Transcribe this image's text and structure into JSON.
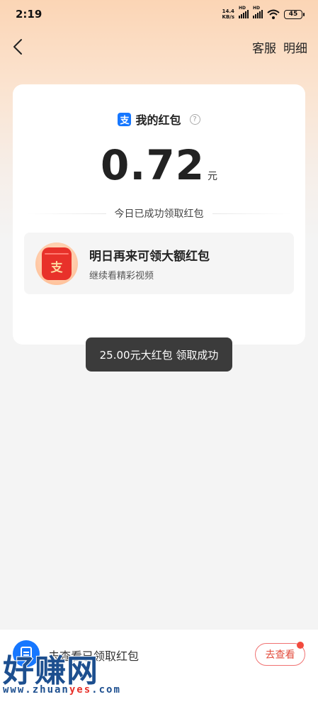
{
  "status_bar": {
    "time": "2:19",
    "net_speed_value": "14.4",
    "net_speed_unit": "KB/s",
    "hd_label": "HD",
    "battery": "45"
  },
  "header": {
    "service_label": "客服",
    "detail_label": "明细"
  },
  "card": {
    "logo_glyph": "支",
    "title": "我的红包",
    "help_glyph": "?",
    "amount": "0.72",
    "amount_unit": "元",
    "success_text": "今日已成功领取红包",
    "promo": {
      "icon_glyph": "支",
      "title": "明日再来可领大额红包",
      "subtitle": "继续看精彩视频"
    }
  },
  "toast": {
    "text": "25.00元大红包 领取成功"
  },
  "bottom_bar": {
    "text": "去查看已领取红包",
    "button_label": "去查看"
  },
  "watermark": {
    "brand": "好赚网",
    "url_pre": "www.zhuan",
    "url_hl": "yes",
    "url_post": ".com"
  },
  "colors": {
    "accent_blue": "#1677ff",
    "red": "#e8312a",
    "toast_bg": "#3b3b3b"
  }
}
